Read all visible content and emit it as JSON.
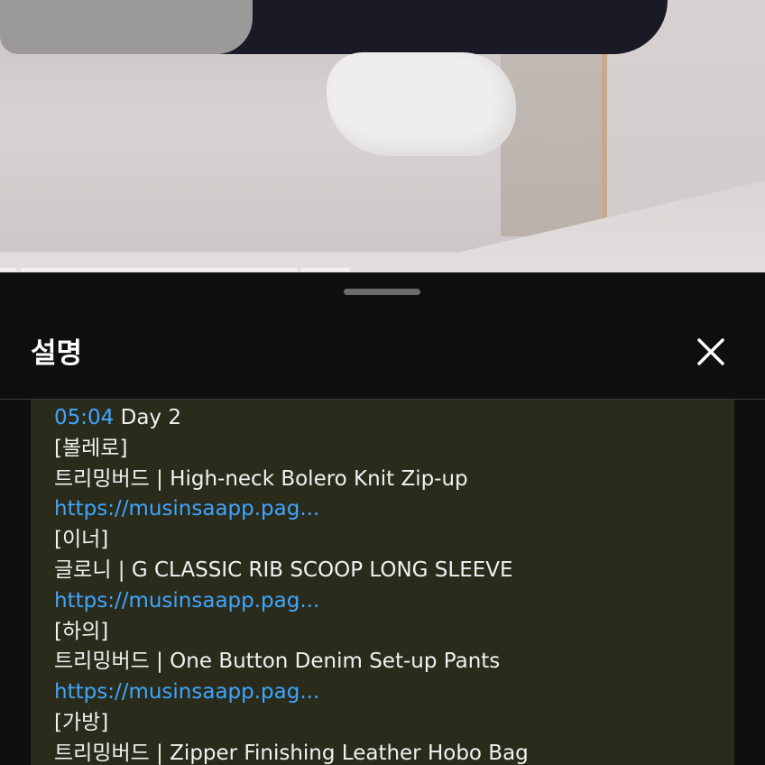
{
  "sheet": {
    "title": "설명"
  },
  "description": {
    "timestamp": "05:04",
    "timestamp_label": "Day 2",
    "lines": [
      {
        "type": "text",
        "text": "[볼레로]"
      },
      {
        "type": "text",
        "text": "트리밍버드 | High-neck Bolero Knit Zip-up"
      },
      {
        "type": "link",
        "text": "https://musinsaapp.pag..."
      },
      {
        "type": "text",
        "text": "[이너]"
      },
      {
        "type": "text",
        "text": "글로니 | G CLASSIC RIB SCOOP LONG SLEEVE"
      },
      {
        "type": "link",
        "text": "https://musinsaapp.pag..."
      },
      {
        "type": "text",
        "text": "[하의]"
      },
      {
        "type": "text",
        "text": "트리밍버드 | One Button Denim Set-up Pants"
      },
      {
        "type": "link",
        "text": "https://musinsaapp.pag..."
      },
      {
        "type": "text",
        "text": "[가방]"
      },
      {
        "type": "text",
        "text": "트리밍버드 | Zipper Finishing Leather Hobo Bag"
      }
    ]
  },
  "icons": {
    "close": "close-icon"
  },
  "colors": {
    "background": "#0f0f0f",
    "link": "#3ea6ff",
    "description_bg": "#2b2b1c",
    "text": "#f1f1f1"
  }
}
